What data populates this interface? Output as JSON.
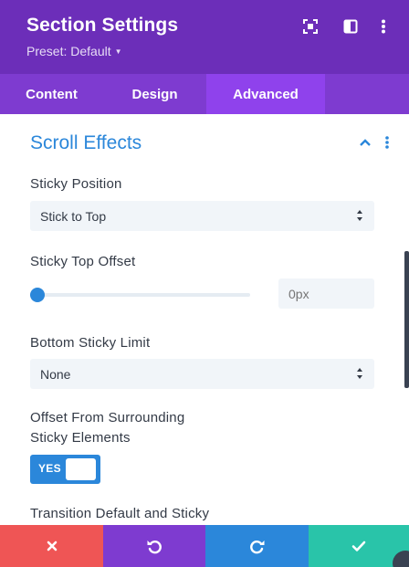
{
  "header": {
    "title": "Section Settings",
    "preset_label": "Preset: Default",
    "bg_color": "#6c2eb9",
    "icons": [
      "expand-icon",
      "sidebar-toggle-icon",
      "more-vertical-icon"
    ]
  },
  "tabs": [
    {
      "label": "Content",
      "active": false
    },
    {
      "label": "Design",
      "active": false
    },
    {
      "label": "Advanced",
      "active": true
    }
  ],
  "section": {
    "title": "Scroll Effects",
    "expanded": true
  },
  "fields": {
    "sticky_position": {
      "label": "Sticky Position",
      "value": "Stick to Top"
    },
    "sticky_top_offset": {
      "label": "Sticky Top Offset",
      "slider_value": 0,
      "placeholder": "0px"
    },
    "bottom_sticky_limit": {
      "label": "Bottom Sticky Limit",
      "value": "None"
    },
    "offset_surrounding": {
      "label_line1": "Offset From Surrounding",
      "label_line2": "Sticky Elements",
      "toggle_label": "YES",
      "enabled": true
    },
    "transition": {
      "label": "Transition Default and Sticky"
    }
  },
  "footer": {
    "buttons": [
      {
        "name": "discard",
        "icon": "close-icon",
        "color": "#ef5555"
      },
      {
        "name": "undo",
        "icon": "undo-icon",
        "color": "#7e3bd0"
      },
      {
        "name": "redo",
        "icon": "redo-icon",
        "color": "#2b87da"
      },
      {
        "name": "save",
        "icon": "check-icon",
        "color": "#29c4a9"
      }
    ]
  },
  "colors": {
    "accent": "#2b87da",
    "tab_bar": "#7e3bd0",
    "tab_active": "#8f42ec"
  }
}
